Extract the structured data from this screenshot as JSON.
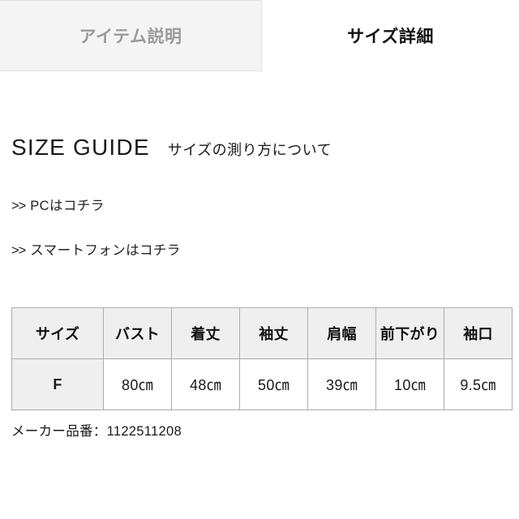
{
  "tabs": [
    {
      "label": "アイテム説明",
      "active": false,
      "name": "tab-item-description"
    },
    {
      "label": "サイズ詳細",
      "active": true,
      "name": "tab-size-details"
    }
  ],
  "guide": {
    "title": "SIZE GUIDE",
    "subtitle": "サイズの測り方について"
  },
  "links": [
    {
      "arrows": ">>",
      "label": "PCはコチラ"
    },
    {
      "arrows": ">>",
      "label": "スマートフォンはコチラ"
    }
  ],
  "size_table": {
    "headers": [
      "サイズ",
      "バスト",
      "着丈",
      "袖丈",
      "肩幅",
      "前下がり",
      "袖口"
    ],
    "rows": [
      [
        "F",
        "80㎝",
        "48㎝",
        "50㎝",
        "39㎝",
        "10㎝",
        "9.5㎝"
      ]
    ]
  },
  "maker": {
    "text": "メーカー品番：1122511208"
  },
  "colors": {
    "tab_inactive_bg": "#f4f4f4",
    "tab_inactive_text": "#9a9a9a",
    "tab_active_text": "#111111",
    "table_border": "#a9aeb3",
    "table_header_bg": "#efefef",
    "page_bg": "#ffffff"
  }
}
